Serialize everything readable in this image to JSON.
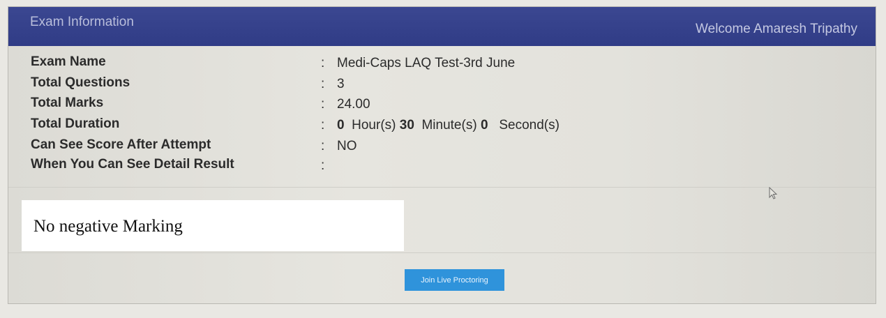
{
  "header": {
    "title": "Exam Information",
    "welcome": "Welcome Amaresh Tripathy"
  },
  "exam_info": {
    "colon": ":",
    "rows": [
      {
        "label": "Exam Name",
        "value": "Medi-Caps LAQ Test-3rd June"
      },
      {
        "label": "Total Questions",
        "value": "3"
      },
      {
        "label": "Total Marks",
        "value": "24.00"
      },
      {
        "label": "Total Duration",
        "hours": "0",
        "hours_unit": "Hour(s)",
        "minutes": "30",
        "minutes_unit": "Minute(s)",
        "seconds": "0",
        "seconds_unit": "Second(s)"
      },
      {
        "label": "Can See Score After Attempt",
        "value": "NO"
      },
      {
        "label": "When You Can See Detail Result",
        "value": ""
      }
    ]
  },
  "note": {
    "text": "No negative Marking"
  },
  "actions": {
    "join_label": "Join Live Proctoring"
  },
  "colors": {
    "header_bg": "#303c86",
    "button_bg": "#2f93db"
  }
}
